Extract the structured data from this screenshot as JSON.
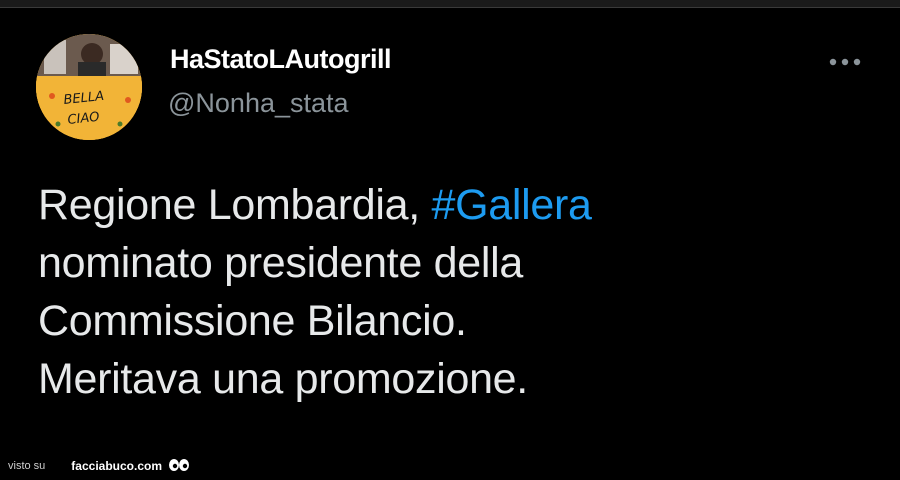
{
  "user": {
    "display_name": "HaStatoLAutogrill",
    "handle": "@Nonha_stata",
    "avatar_text_line1": "BELLA",
    "avatar_text_line2": "CIAO"
  },
  "tweet": {
    "line1_text": "Regione Lombardia, ",
    "line1_hashtag": "#Gallera",
    "line2": "nominato presidente della",
    "line3": "Commissione Bilancio.",
    "line4": "Meritava una promozione."
  },
  "more_icon": "more-horizontal-icon",
  "watermark": {
    "prefix": "visto su",
    "site": "facciabuco.com",
    "logo_icon": "eyes-icon"
  },
  "colors": {
    "background": "#000000",
    "text": "#e7e9ea",
    "secondary_text": "#8b949a",
    "hashtag": "#1d9bf0",
    "avatar_bg": "#f2b437"
  }
}
